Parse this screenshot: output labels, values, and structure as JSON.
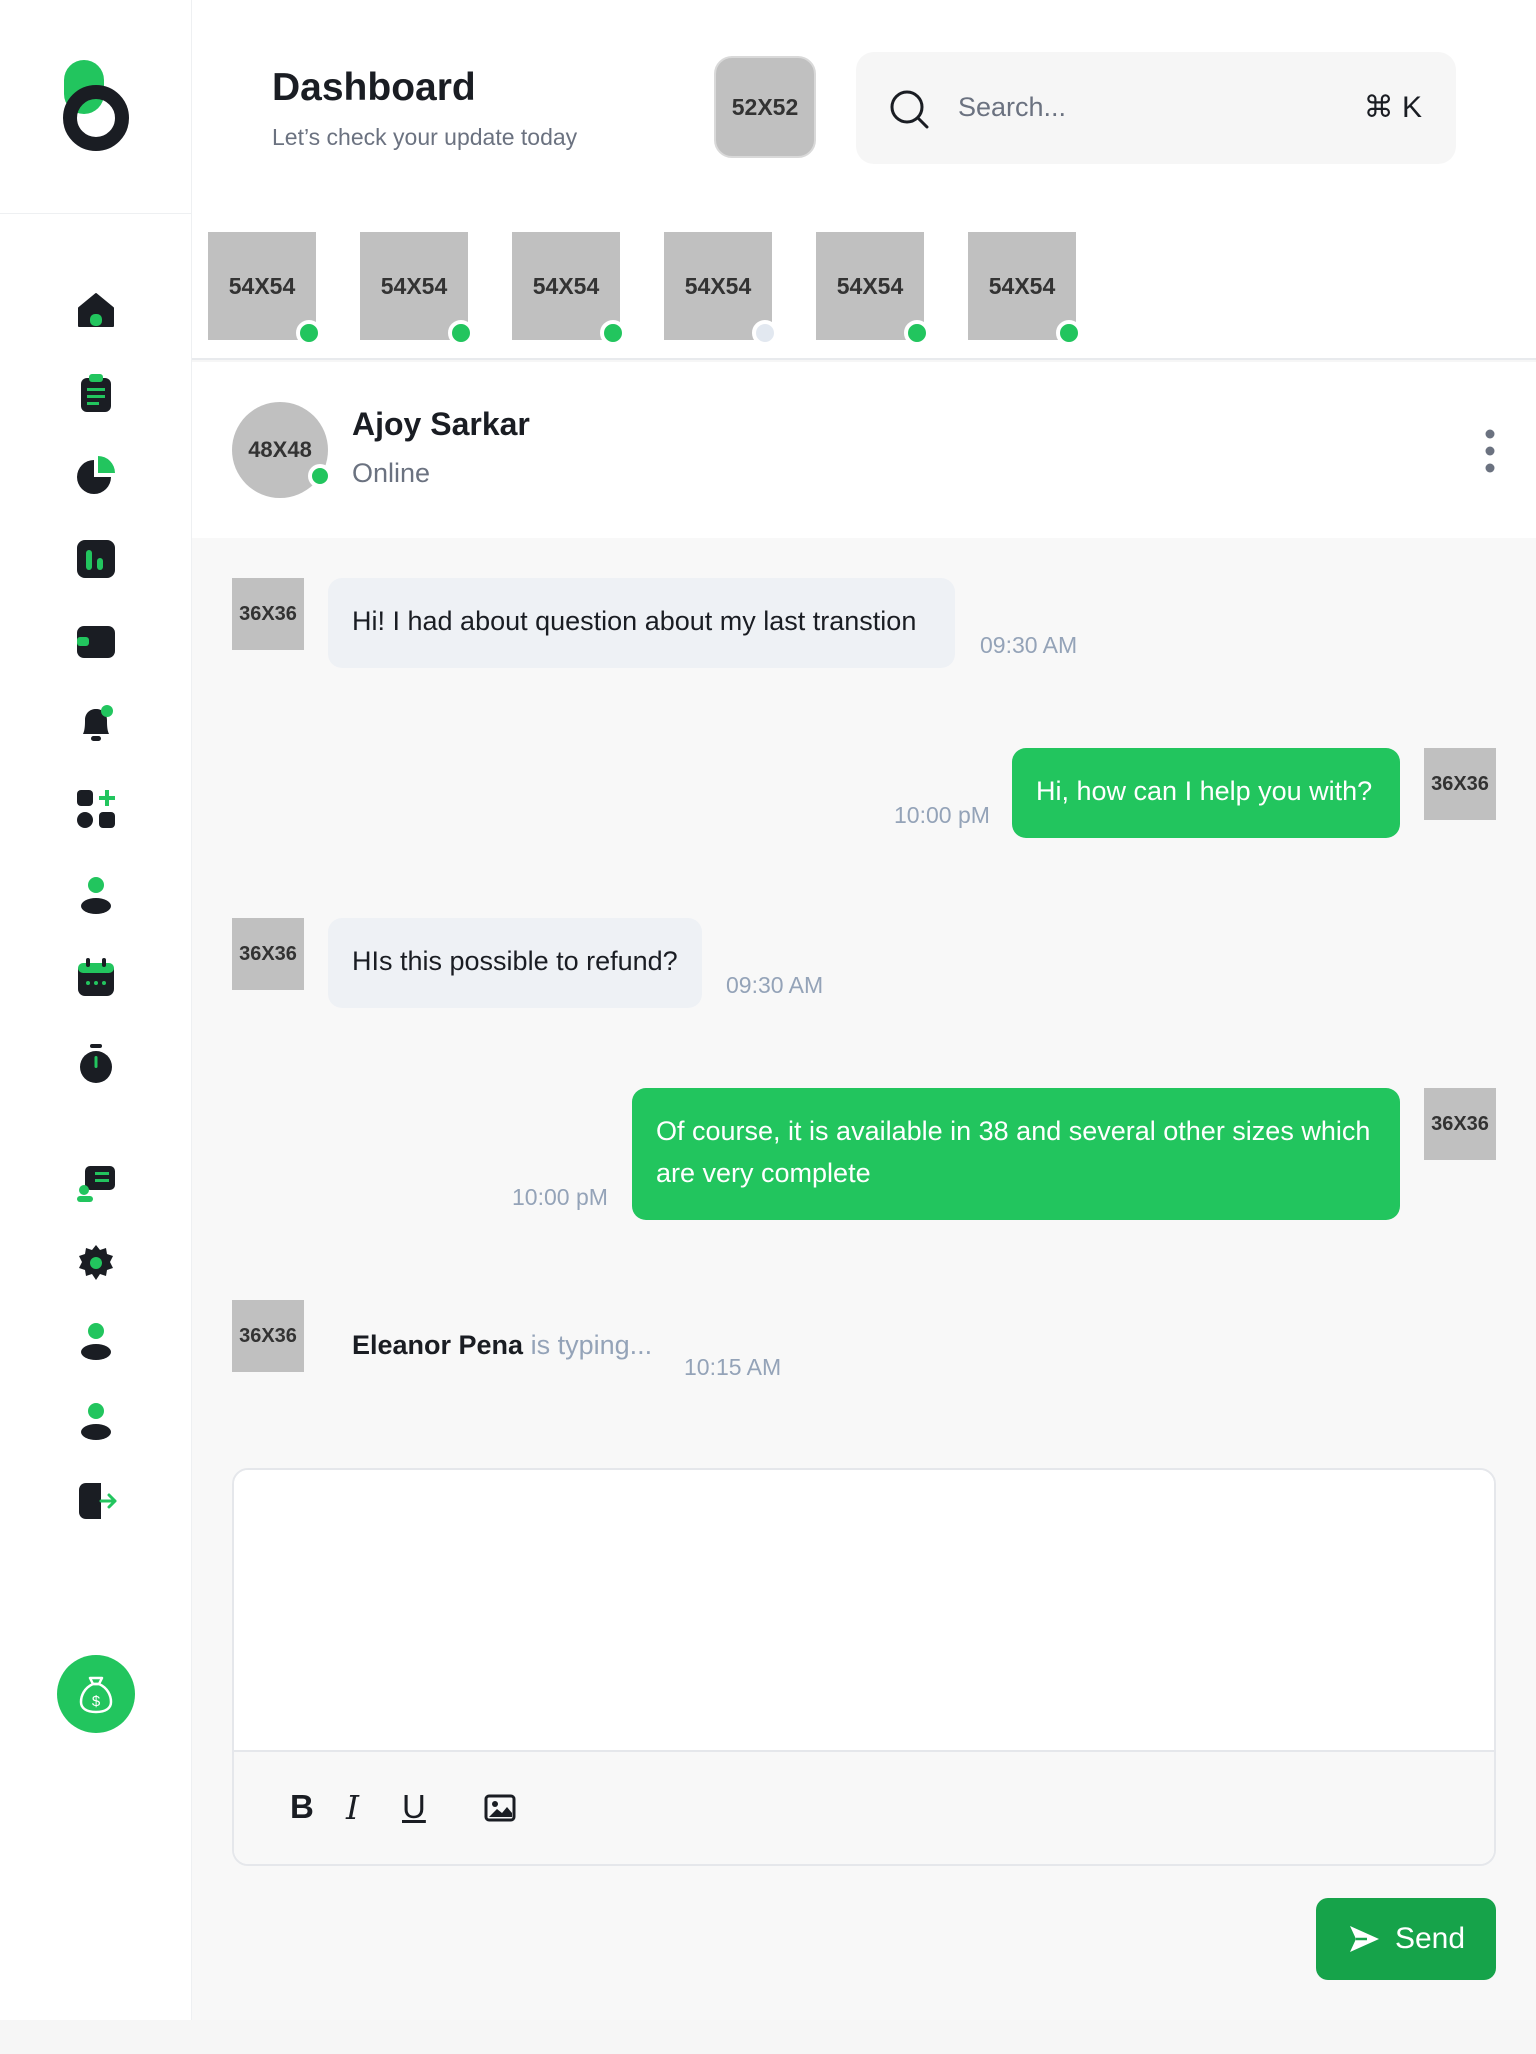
{
  "header": {
    "title": "Dashboard",
    "subtitle": "Let’s check your update today",
    "avatar_label": "52X52"
  },
  "search": {
    "placeholder": "Search...",
    "shortcut": "⌘ K"
  },
  "stories": [
    {
      "label": "54X54",
      "status": "online"
    },
    {
      "label": "54X54",
      "status": "online"
    },
    {
      "label": "54X54",
      "status": "online"
    },
    {
      "label": "54X54",
      "status": "away"
    },
    {
      "label": "54X54",
      "status": "online"
    },
    {
      "label": "54X54",
      "status": "online"
    }
  ],
  "chat": {
    "avatar_label": "48X48",
    "name": "Ajoy Sarkar",
    "status": "Online"
  },
  "messages": [
    {
      "direction": "in",
      "avatar": "36X36",
      "text": "Hi! I had about question about my last transtion",
      "time": "09:30 AM"
    },
    {
      "direction": "out",
      "avatar": "36X36",
      "text": "Hi, how can I help you with?",
      "time": "10:00 pM"
    },
    {
      "direction": "in",
      "avatar": "36X36",
      "text": "HIs this possible to refund?",
      "time": "09:30 AM"
    },
    {
      "direction": "out",
      "avatar": "36X36",
      "text": "Of course, it is available in 38 and several other sizes which are very complete",
      "time": "10:00 pM"
    }
  ],
  "typing": {
    "avatar": "36X36",
    "name": "Eleanor Pena",
    "text": " is typing...",
    "time": "10:15 AM"
  },
  "composer": {
    "bold": "B",
    "italic": "I",
    "underline": "U",
    "send_label": "Send"
  },
  "sidebar": {
    "icons": [
      "home-icon",
      "clipboard-icon",
      "pie-chart-icon",
      "bar-chart-icon",
      "wallet-icon",
      "bell-icon",
      "apps-add-icon",
      "user-icon",
      "calendar-icon",
      "timer-icon",
      "chat-support-icon",
      "settings-icon",
      "user-icon",
      "user-icon",
      "logout-icon"
    ]
  },
  "colors": {
    "accent": "#22c55e",
    "accent_dark": "#16a34a",
    "dark": "#1a1d23"
  }
}
